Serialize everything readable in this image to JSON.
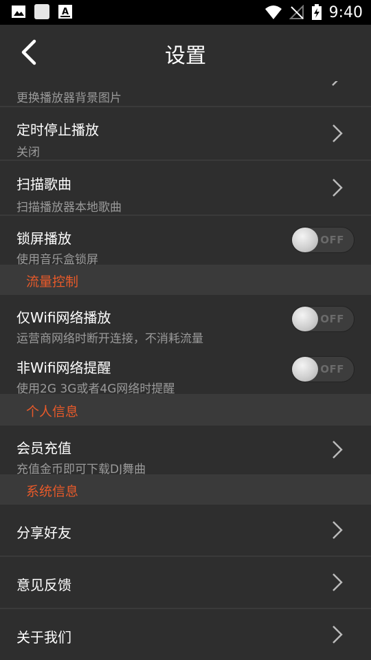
{
  "status": {
    "time": "9:40",
    "left_icons": [
      "image-icon",
      "app-square-icon",
      "a-badge-icon"
    ],
    "right_icons": [
      "wifi-icon",
      "no-signal-icon",
      "battery-charging-icon"
    ]
  },
  "header": {
    "title": "设置",
    "back_icon": "chevron-left-icon"
  },
  "rows": {
    "bg_change": {
      "subtitle": "更换播放器背景图片"
    },
    "timer_stop": {
      "title": "定时停止播放",
      "subtitle": "关闭"
    },
    "scan_songs": {
      "title": "扫描歌曲",
      "subtitle": "扫描播放器本地歌曲"
    },
    "lockscreen": {
      "title": "锁屏播放",
      "subtitle": "使用音乐盒锁屏",
      "toggle": "OFF",
      "on": false
    },
    "wifi_only": {
      "title": "仅Wifi网络播放",
      "subtitle": "运营商网络时断开连接，不消耗流量",
      "toggle": "OFF",
      "on": false
    },
    "non_wifi_alert": {
      "title": "非Wifi网络提醒",
      "subtitle": "使用2G 3G或者4G网络时提醒",
      "toggle": "OFF",
      "on": false
    },
    "vip_recharge": {
      "title": "会员充值",
      "subtitle": "充值金币即可下载DJ舞曲"
    },
    "share_friends": {
      "title": "分享好友"
    },
    "feedback": {
      "title": "意见反馈"
    },
    "about_us": {
      "title": "关于我们"
    }
  },
  "sections": {
    "traffic": "流量控制",
    "personal": "个人信息",
    "system": "系统信息"
  },
  "colors": {
    "accent": "#e85a2a",
    "background": "#2e2e2e",
    "section_bg": "#3a3a3a"
  }
}
